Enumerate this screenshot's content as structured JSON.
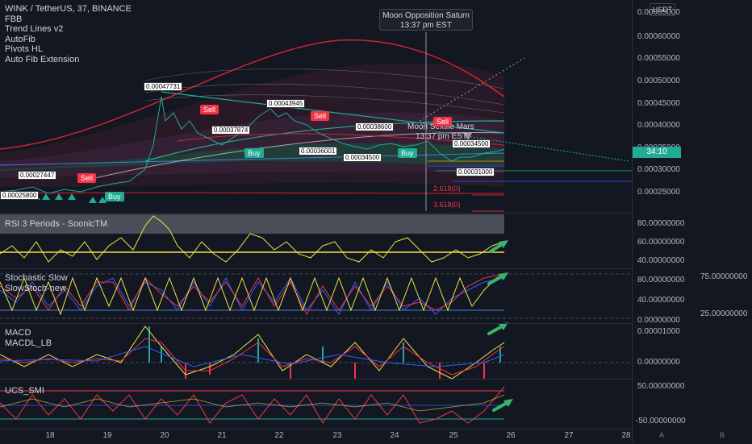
{
  "symbol_legend": [
    "WINK / TetherUS, 37, BINANCE",
    "FBB",
    "Trend Lines v2",
    "AutoFib",
    "Pivots HL",
    "Auto Fib Extension"
  ],
  "currency_label": "USDT",
  "current_price_tag": "34:10",
  "price_ticks": [
    "0.00065000",
    "0.00060000",
    "0.00055000",
    "0.00050000",
    "0.00045000",
    "0.00040000",
    "0.00035000",
    "0.00030000",
    "0.00025000"
  ],
  "tooltip": {
    "title": "Moon Opposition Saturn",
    "time": "13:37 pm EST"
  },
  "overlay_text": {
    "moon_label": "Moon Sextile Mars",
    "moon_time": "13:37 pm EST"
  },
  "box_labels": [
    "0.00047731",
    "0.00043945",
    "0.00037874",
    "0.00038600",
    "0.00036001",
    "0.00034500",
    "0.00027447",
    "0.00025800",
    "0.00034500",
    "0.00031000"
  ],
  "signals": {
    "sell": "Sell",
    "buy": "Buy"
  },
  "fib_labels": [
    "2.618(0)",
    "3.618(0)"
  ],
  "indicators": {
    "rsi": {
      "title": "RSI 3 Periods - SoonicTM",
      "ticks": [
        "80.00000000",
        "60.00000000",
        "40.00000000"
      ]
    },
    "stoch": {
      "title1": "Stochastic Slow",
      "title2": "SlowStoch-new",
      "ticks": [
        "80.00000000",
        "40.00000000",
        "0.00000000"
      ],
      "ticks_right": [
        "75.00000000",
        "25.00000000"
      ]
    },
    "macd": {
      "title1": "MACD",
      "title2": "MACDL_LB",
      "ticks": [
        "0.00001000",
        "0.00000000"
      ]
    },
    "smi": {
      "title": "UCS_SMI",
      "ticks": [
        "50.00000000",
        "-50.00000000"
      ]
    }
  },
  "time_labels": [
    "18",
    "19",
    "20",
    "21",
    "22",
    "23",
    "24",
    "25",
    "26",
    "27",
    "28"
  ],
  "axis_buttons": [
    "A",
    "B"
  ],
  "colors": {
    "background": "#131722",
    "red": "#f23645",
    "green": "#22ab94",
    "yellow": "#f0e442",
    "blue": "#2962ff"
  }
}
